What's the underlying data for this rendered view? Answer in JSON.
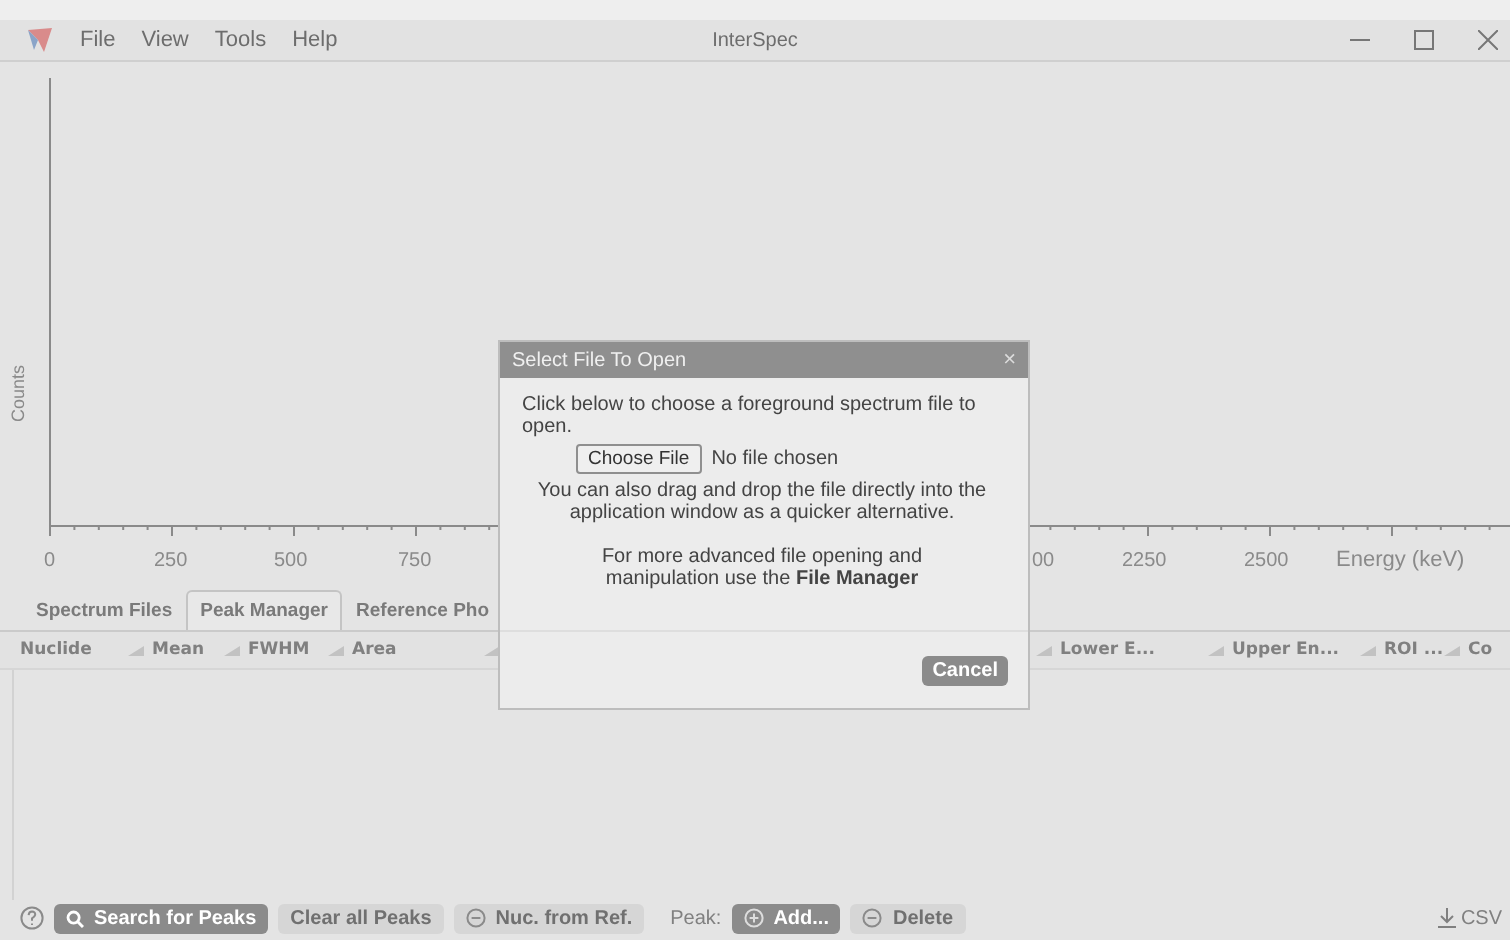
{
  "window": {
    "title": "InterSpec",
    "menu": [
      "File",
      "View",
      "Tools",
      "Help"
    ]
  },
  "chart": {
    "ylabel": "Counts",
    "xlabel": "Energy (keV)",
    "tick_labels": [
      "0",
      "250",
      "500",
      "750",
      "00",
      "2250",
      "2500"
    ]
  },
  "tabs": [
    {
      "label": "Spectrum Files",
      "selected": false
    },
    {
      "label": "Peak Manager",
      "selected": true
    },
    {
      "label": "Reference Pho",
      "selected": false
    }
  ],
  "table": {
    "columns": [
      "Nuclide",
      "Mean",
      "FWHM",
      "Area",
      "Lower E...",
      "Upper En...",
      "ROI ...",
      "Co"
    ]
  },
  "toolbar": {
    "buttons": [
      {
        "label": "Search for Peaks",
        "disabled": false,
        "kind": "search"
      },
      {
        "label": "Clear all Peaks",
        "disabled": true,
        "kind": "plain"
      },
      {
        "label": "Nuc. from Ref.",
        "disabled": true,
        "kind": "minus"
      }
    ],
    "peak_label": "Peak:",
    "peak_buttons": [
      {
        "label": "Add...",
        "disabled": false,
        "kind": "plus"
      },
      {
        "label": "Delete",
        "disabled": true,
        "kind": "minus"
      }
    ],
    "export": "CSV"
  },
  "dialog": {
    "title": "Select File To Open",
    "close": "×",
    "intro": "Click below to choose a foreground spectrum file to open.",
    "file_button": "Choose File",
    "file_status": "No file chosen",
    "drag_note": "You can also drag and drop the file directly into the application window as a quicker alternative.",
    "advanced_note": "For more advanced file opening and manipulation use the **File Manager**",
    "cancel": "Cancel"
  }
}
